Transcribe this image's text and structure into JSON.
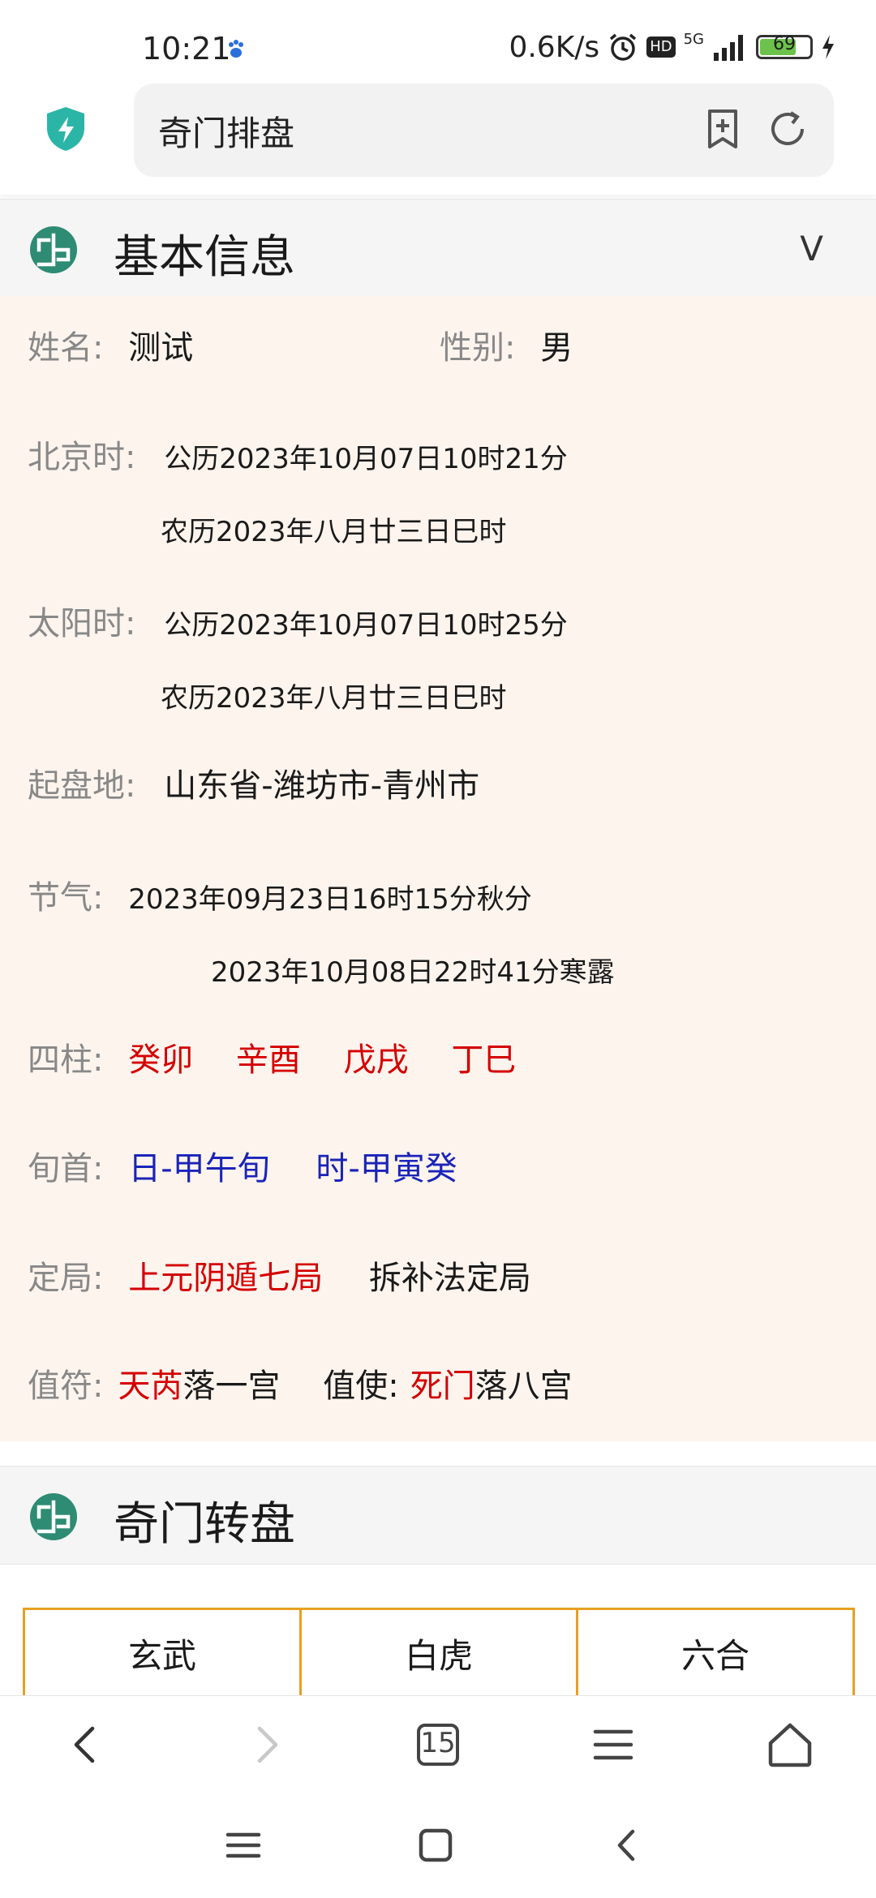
{
  "status_bar": {
    "time": "10:21",
    "net_speed": "0.6K/s",
    "network": "5G",
    "hd": "HD",
    "battery_level": "69",
    "battery_fraction": 0.69
  },
  "address_bar": {
    "title": "奇门排盘"
  },
  "basic_info": {
    "title": "基本信息",
    "toggle": "V",
    "name_label": "姓名:",
    "name_value": "测试",
    "gender_label": "性别:",
    "gender_value": "男",
    "beijing_label": "北京时:",
    "beijing_solar": "公历2023年10月07日10时21分",
    "beijing_lunar": "农历2023年八月廿三日巳时",
    "sun_label": "太阳时:",
    "sun_solar": "公历2023年10月07日10时25分",
    "sun_lunar": "农历2023年八月廿三日巳时",
    "place_label": "起盘地:",
    "place_value": "山东省-潍坊市-青州市",
    "jieqi_label": "节气:",
    "jieqi_1": "2023年09月23日16时15分秋分",
    "jieqi_2": "2023年10月08日22时41分寒露",
    "sizhu_label": "四柱:",
    "sizhu": [
      "癸卯",
      "辛酉",
      "戊戌",
      "丁巳"
    ],
    "xunshou_label": "旬首:",
    "xunshou_day": "日-甲午旬",
    "xunshou_hour": "时-甲寅癸",
    "dingju_label": "定局:",
    "dingju_value": "上元阴遁七局",
    "dingju_method": "拆补法定局",
    "zhifu_label": "值符:",
    "zhifu_star": "天芮",
    "zhifu_palace": "落一宫",
    "zhishi_label": "值使:",
    "zhishi_door": "死门",
    "zhishi_palace": "落八宫"
  },
  "qimen": {
    "title": "奇门转盘",
    "top_row": [
      "玄武",
      "白虎",
      "六合"
    ]
  },
  "browser_nav": {
    "tab_count": "15"
  },
  "colors": {
    "red": "#d40000",
    "blue": "#1a24b8",
    "label_gray": "#888888",
    "panel_bg": "#fdf4ee",
    "grid_border": "#e8a020",
    "shield": "#2bb5a7",
    "logo": "#2e8b74"
  }
}
